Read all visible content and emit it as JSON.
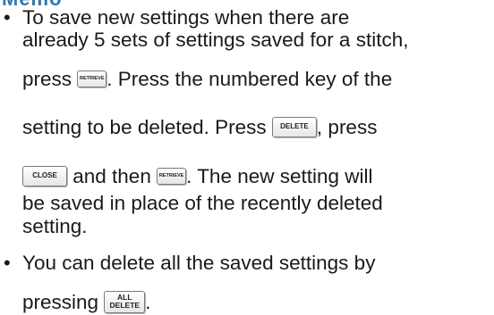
{
  "memo": {
    "title": "Memo"
  },
  "bullet_glyph": "•",
  "para1": {
    "l1": "To save new settings when there are",
    "l2": "already 5 sets of settings saved for a stitch,",
    "l3_before": "press ",
    "l3_after": ". Press the numbered key of the",
    "l4_before": "setting to be deleted. Press ",
    "l4_after": ", press",
    "l5_between": " and then ",
    "l5_after": ". The new setting will",
    "l6": "be saved in place of the recently deleted",
    "l7": "setting."
  },
  "para2": {
    "l1": "You can delete all the saved settings by",
    "l2_before": "pressing ",
    "l2_after": "."
  },
  "keys": {
    "retrieve": "RETRIEVE",
    "delete": "DELETE",
    "close": "CLOSE",
    "all_delete_top": "ALL",
    "all_delete_bottom": "DELETE"
  }
}
